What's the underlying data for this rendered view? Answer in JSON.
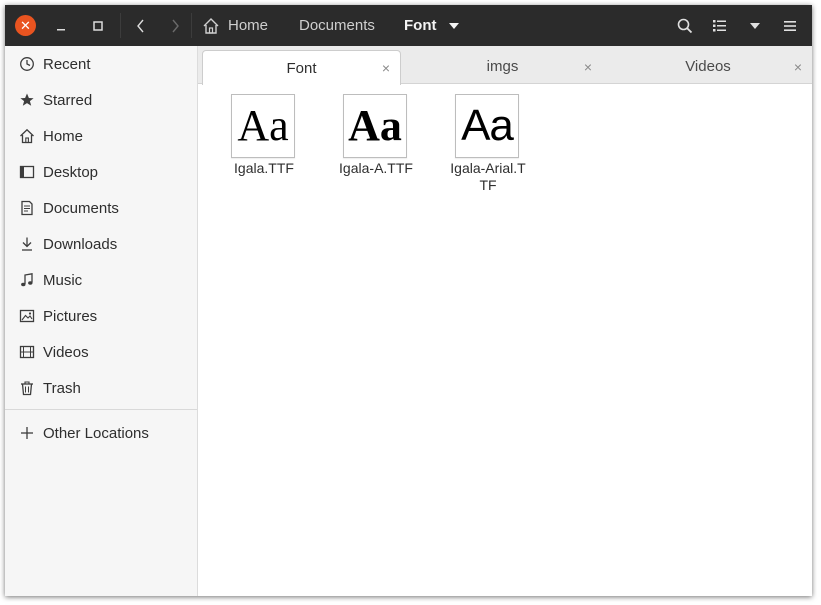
{
  "window": {
    "close_glyph": "✕",
    "minimize_glyph": "–",
    "maximize_glyph": "□"
  },
  "nav": {
    "back_glyph": "〈",
    "forward_glyph": "〉"
  },
  "breadcrumb": {
    "home": "Home",
    "documents": "Documents",
    "current": "Font"
  },
  "sidebar": {
    "items": [
      {
        "label": "Recent",
        "icon": "clock-icon"
      },
      {
        "label": "Starred",
        "icon": "star-icon"
      },
      {
        "label": "Home",
        "icon": "home-icon"
      },
      {
        "label": "Desktop",
        "icon": "desktop-icon"
      },
      {
        "label": "Documents",
        "icon": "document-icon"
      },
      {
        "label": "Downloads",
        "icon": "download-icon"
      },
      {
        "label": "Music",
        "icon": "music-icon"
      },
      {
        "label": "Pictures",
        "icon": "picture-icon"
      },
      {
        "label": "Videos",
        "icon": "video-icon"
      },
      {
        "label": "Trash",
        "icon": "trash-icon"
      }
    ],
    "other_locations": "Other Locations"
  },
  "tabs": [
    {
      "label": "Font",
      "active": true
    },
    {
      "label": "imgs",
      "active": false
    },
    {
      "label": "Videos",
      "active": false
    }
  ],
  "tab_close_glyph": "×",
  "files": [
    {
      "name": "Igala.TTF",
      "preview": "Aa"
    },
    {
      "name": "Igala-A.TTF",
      "preview": "Aa"
    },
    {
      "name": "Igala-Arial.TTF",
      "preview": "Aa"
    }
  ],
  "colors": {
    "accent": "#e95420",
    "header": "#2b2b2b",
    "sidebar": "#f6f6f6"
  }
}
